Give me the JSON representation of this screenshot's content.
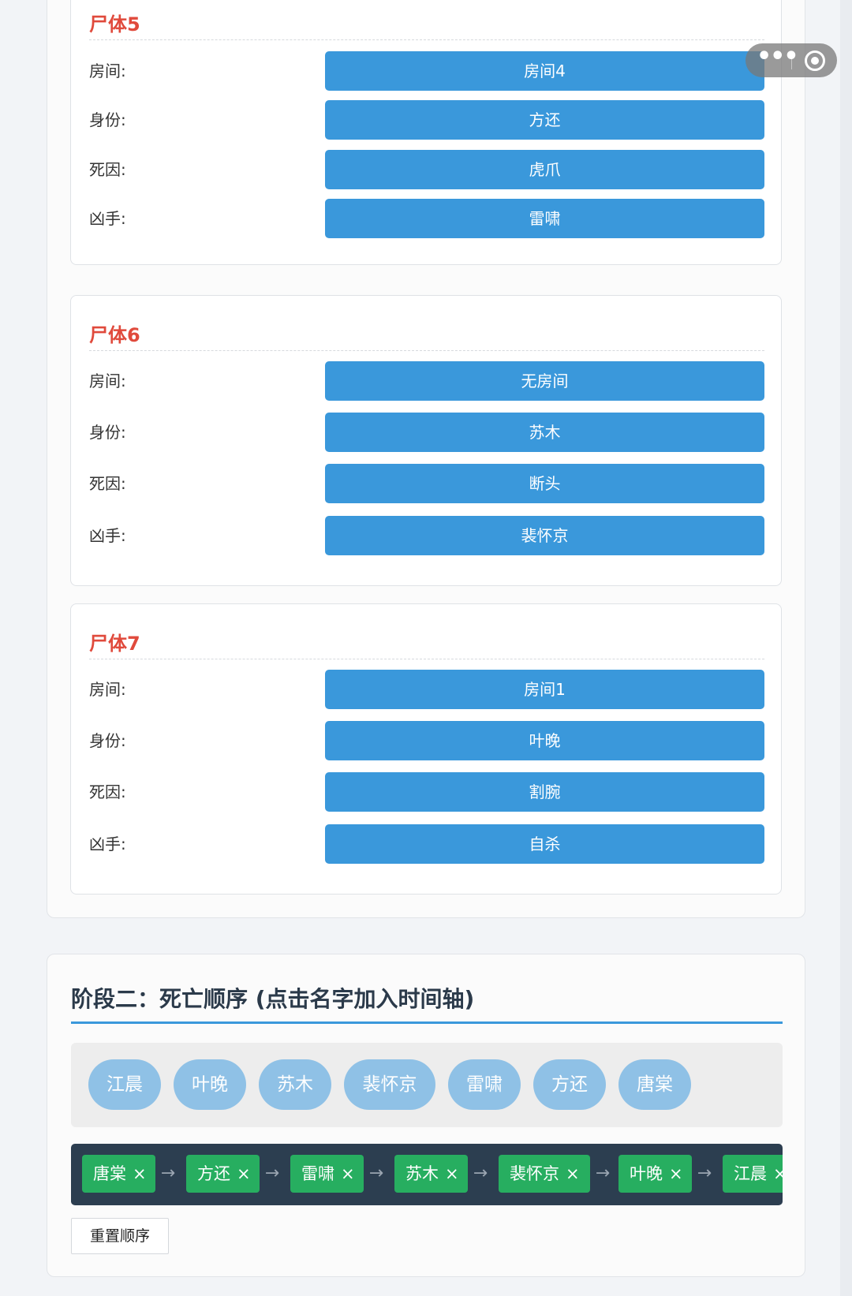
{
  "field_labels": {
    "room": "房间:",
    "identity": "身份:",
    "cause": "死因:",
    "killer": "凶手:"
  },
  "bodies": [
    {
      "title": "尸体5",
      "room": "房间4",
      "identity": "方还",
      "cause": "虎爪",
      "killer": "雷啸"
    },
    {
      "title": "尸体6",
      "room": "无房间",
      "identity": "苏木",
      "cause": "断头",
      "killer": "裴怀京"
    },
    {
      "title": "尸体7",
      "room": "房间1",
      "identity": "叶晚",
      "cause": "割腕",
      "killer": "自杀"
    }
  ],
  "stage2": {
    "title": "阶段二：死亡顺序 (点击名字加入时间轴)",
    "names": [
      "江晨",
      "叶晚",
      "苏木",
      "裴怀京",
      "雷啸",
      "方还",
      "唐棠"
    ],
    "timeline": [
      "唐棠",
      "方还",
      "雷啸",
      "苏木",
      "裴怀京",
      "叶晚",
      "江晨"
    ],
    "remove_glyph": "×",
    "arrow_glyph": "→",
    "reset_label": "重置顺序"
  },
  "capsule": {
    "more_glyph": "•••"
  },
  "colors": {
    "accent_blue": "#3a98db",
    "title_red": "#e04a3c",
    "chip_blue": "#8fc1e6",
    "timeline_bg": "#2c3e50",
    "timeline_green": "#27ae60"
  }
}
